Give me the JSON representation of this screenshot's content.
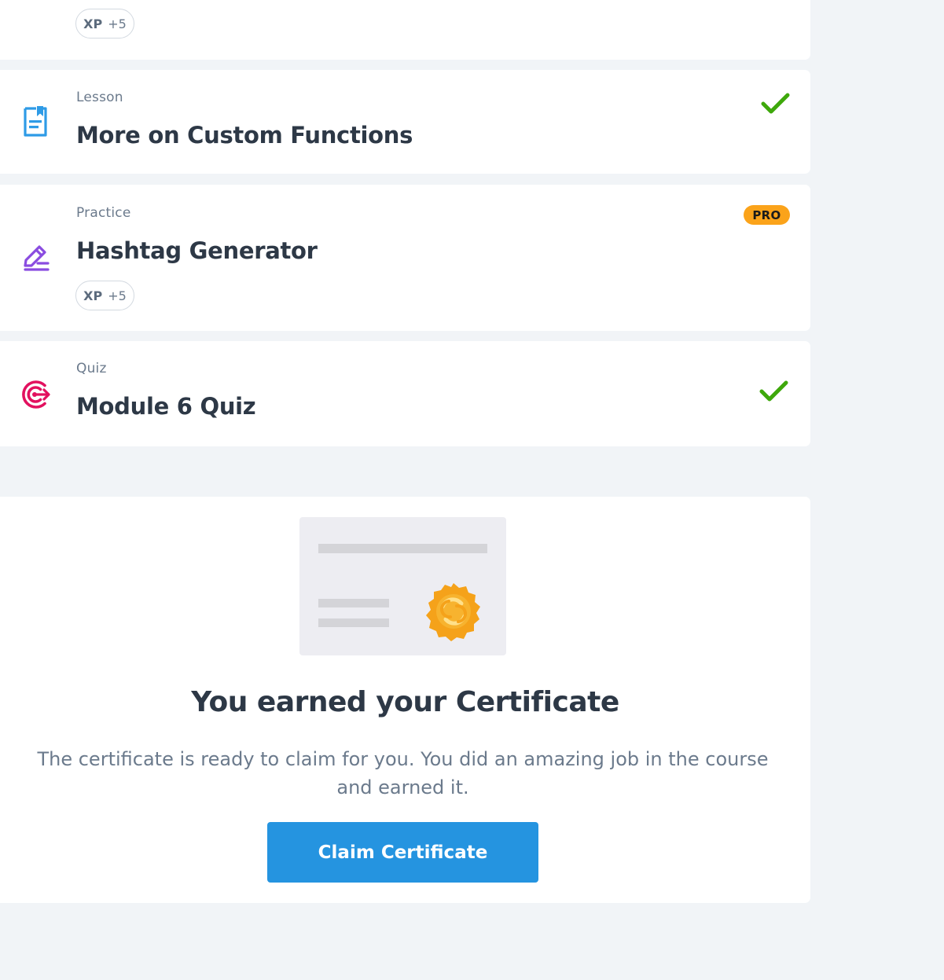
{
  "items": {
    "top": {
      "xp_label": "XP",
      "xp_value": "+5"
    },
    "lesson": {
      "type": "Lesson",
      "title": "More on Custom Functions",
      "icon": "lesson-document-icon",
      "completed": true
    },
    "practice": {
      "type": "Practice",
      "title": "Hashtag Generator",
      "icon": "pencil-edit-icon",
      "badge": "PRO",
      "xp_label": "XP",
      "xp_value": "+5"
    },
    "quiz": {
      "type": "Quiz",
      "title": "Module 6 Quiz",
      "icon": "target-icon",
      "completed": true
    }
  },
  "certificate": {
    "title": "You earned your Certificate",
    "text": "The certificate is ready to claim for you. You did an amazing job in the course and earned it.",
    "button_label": "Claim Certificate"
  },
  "colors": {
    "accent": "#2594e0",
    "success": "#3ea80b",
    "pro": "#fba31a",
    "lesson_icon": "#2e9be6",
    "practice_icon": "#8a4ce0",
    "quiz_icon": "#e2115f",
    "background": "#f1f4f7"
  }
}
